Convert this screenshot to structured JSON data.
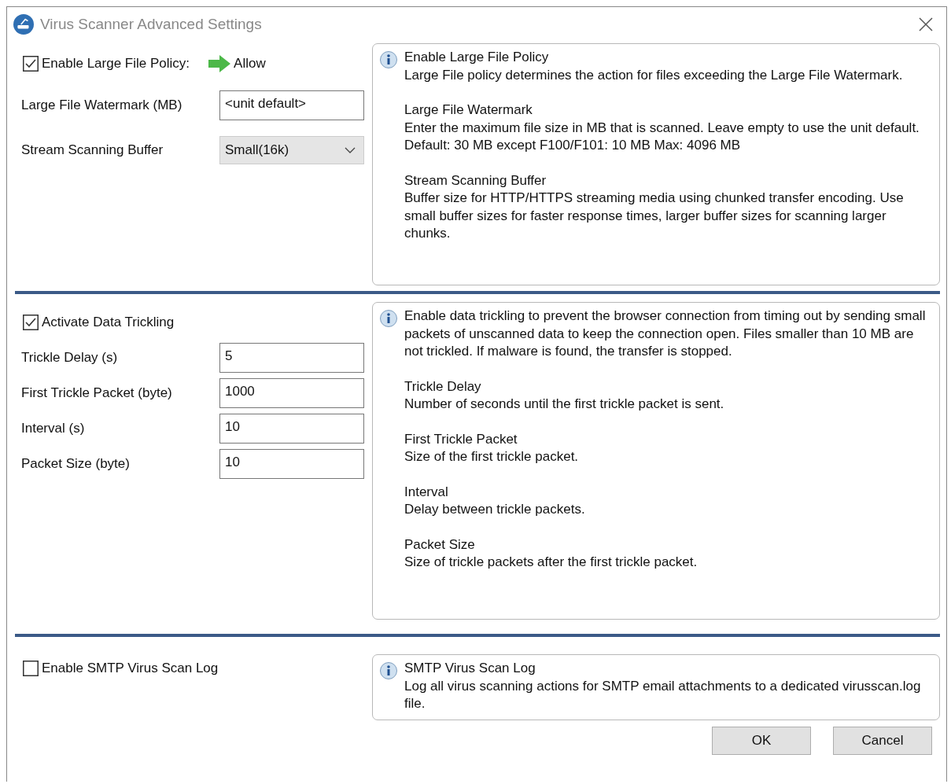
{
  "window": {
    "title": "Virus Scanner Advanced Settings"
  },
  "sections": [
    {
      "checkbox": {
        "label": "Enable Large File Policy:",
        "checked": true
      },
      "action": {
        "label": "Allow"
      },
      "fields": [
        {
          "kind": "text",
          "label": "Large File Watermark (MB)",
          "value": "<unit default>"
        },
        {
          "kind": "dropdown",
          "label": "Stream Scanning Buffer",
          "value": "Small(16k)"
        }
      ],
      "info": [
        {
          "title": "Enable Large File Policy",
          "text": "Large File policy determines the action for files exceeding the Large File Watermark."
        },
        {
          "title": "Large File Watermark",
          "text": "Enter the maximum file size in MB that is scanned. Leave empty to use the unit default. Default: 30 MB except F100/F101: 10 MB Max: 4096 MB"
        },
        {
          "title": "Stream Scanning Buffer",
          "text": "Buffer size for HTTP/HTTPS streaming media using chunked transfer encoding. Use small buffer sizes for faster response times, larger buffer sizes for scanning larger chunks."
        }
      ]
    },
    {
      "checkbox": {
        "label": "Activate Data Trickling",
        "checked": true
      },
      "fields": [
        {
          "kind": "text",
          "label": "Trickle Delay (s)",
          "value": "5"
        },
        {
          "kind": "text",
          "label": "First Trickle Packet (byte)",
          "value": "1000"
        },
        {
          "kind": "text",
          "label": "Interval (s)",
          "value": "10"
        },
        {
          "kind": "text",
          "label": "Packet Size (byte)",
          "value": "10"
        }
      ],
      "info": [
        {
          "text": "Enable data trickling to prevent the browser connection from timing out by sending small packets of unscanned data to keep the connection open. Files smaller than 10 MB are not trickled. If malware is found, the transfer is stopped."
        },
        {
          "title": "Trickle Delay",
          "text": "Number of seconds until the first trickle packet is sent."
        },
        {
          "title": "First Trickle Packet",
          "text": "Size of the first trickle packet."
        },
        {
          "title": "Interval",
          "text": "Delay between trickle packets."
        },
        {
          "title": "Packet Size",
          "text": "Size of trickle packets after the first trickle packet."
        }
      ]
    },
    {
      "checkbox": {
        "label": "Enable SMTP Virus Scan Log",
        "checked": false
      },
      "info": [
        {
          "title": "SMTP Virus Scan Log",
          "text": "Log all virus scanning actions for SMTP email attachments to a dedicated virusscan.log file."
        }
      ]
    }
  ],
  "buttons": [
    "OK",
    "Cancel"
  ]
}
